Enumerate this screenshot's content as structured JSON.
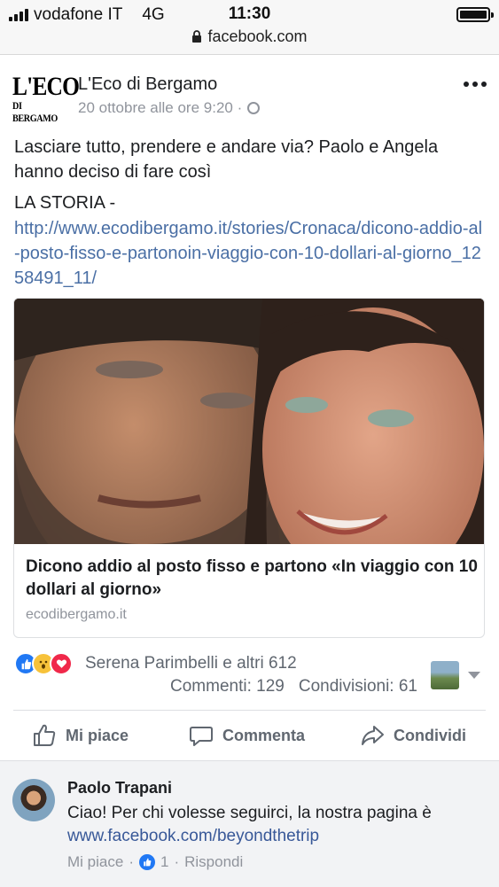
{
  "status_bar": {
    "carrier": "vodafone IT",
    "network": "4G",
    "time": "11:30",
    "url": "facebook.com"
  },
  "post": {
    "page_name": "L'Eco di Bergamo",
    "logo_line1": "L'ECO",
    "logo_line2": "DI BERGAMO",
    "timestamp": "20 ottobre alle ore 9:20 ·",
    "text": "Lasciare tutto, prendere e andare via? Paolo e Angela hanno deciso di fare così",
    "storia": "LA STORIA -",
    "link": "http://www.ecodibergamo.it/stories/Cronaca/dicono-addio-al-posto-fisso-e-partonoin-viaggio-con-10-dollari-al-giorno_1258491_11/"
  },
  "card": {
    "title": "Dicono addio al posto fisso e partono «In viaggio con 10 dollari al giorno»",
    "domain": "ecodibergamo.it"
  },
  "reactions": {
    "summary": "Serena Parimbelli e altri 612",
    "comments": "Commenti: 129",
    "shares": "Condivisioni: 61"
  },
  "actions": {
    "like": "Mi piace",
    "comment": "Commenta",
    "share": "Condividi"
  },
  "comment": {
    "author": "Paolo Trapani",
    "text": "Ciao! Per chi volesse seguirci, la nostra pagina è",
    "link": "www.facebook.com/beyondthetrip",
    "like_label": "Mi piace",
    "sep": "·",
    "like_count": "1",
    "reply_label": "Rispondi"
  },
  "colors": {
    "link": "#4a6fa5",
    "like_blue": "#2078f4",
    "meta_gray": "#90949c"
  }
}
